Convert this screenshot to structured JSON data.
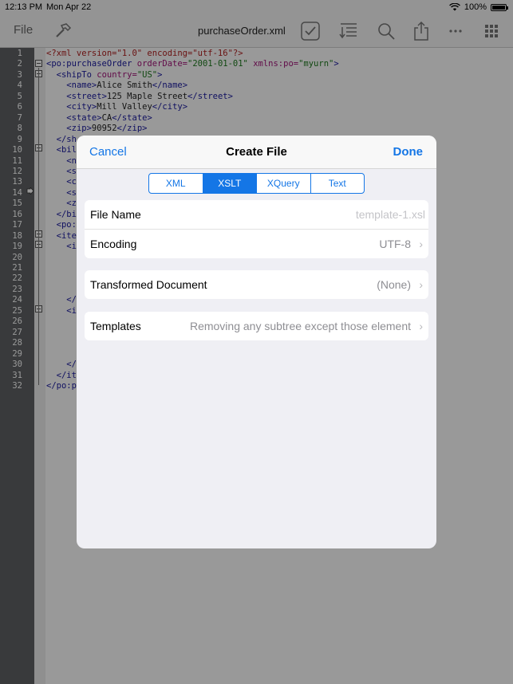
{
  "status_bar": {
    "time": "12:13 PM",
    "date": "Mon Apr 22",
    "battery": "100%"
  },
  "toolbar": {
    "file_label": "File",
    "title": "purchaseOrder.xml"
  },
  "editor": {
    "line_numbers": [
      "1",
      "2",
      "3",
      "4",
      "5",
      "6",
      "7",
      "8",
      "9",
      "10",
      "11",
      "12",
      "13",
      "14",
      "15",
      "16",
      "17",
      "18",
      "19",
      "20",
      "21",
      "22",
      "23",
      "24",
      "25",
      "26",
      "27",
      "28",
      "29",
      "30",
      "31",
      "32"
    ],
    "lines": [
      "<?xml version=\"1.0\" encoding=\"utf-16\"?>",
      "<po:purchaseOrder orderDate=\"2001-01-01\" xmlns:po=\"myurn\">",
      "  <shipTo country=\"US\">",
      "    <name>Alice Smith</name>",
      "    <street>125 Maple Street</street>",
      "    <city>Mill Valley</city>",
      "    <state>CA</state>",
      "    <zip>90952</zip>",
      "  </sh",
      "  <bil",
      "    <n",
      "    <s",
      "    <c",
      "    <s",
      "    <z",
      "  </bi",
      "  <po:",
      "  <ite",
      "    <i",
      "",
      "",
      "",
      "",
      "    </",
      "    <i",
      "",
      "",
      "",
      "",
      "    </",
      "  </it",
      "</po:p"
    ]
  },
  "dialog": {
    "cancel_label": "Cancel",
    "title": "Create File",
    "done_label": "Done",
    "segments": [
      {
        "label": "XML"
      },
      {
        "label": "XSLT"
      },
      {
        "label": "XQuery"
      },
      {
        "label": "Text"
      }
    ],
    "file_name_label": "File Name",
    "file_name_placeholder": "template-1.xsl",
    "encoding_label": "Encoding",
    "encoding_value": "UTF-8",
    "transformed_label": "Transformed Document",
    "transformed_value": "(None)",
    "templates_label": "Templates",
    "templates_value": "Removing any subtree except those element",
    "chevron": "›"
  }
}
